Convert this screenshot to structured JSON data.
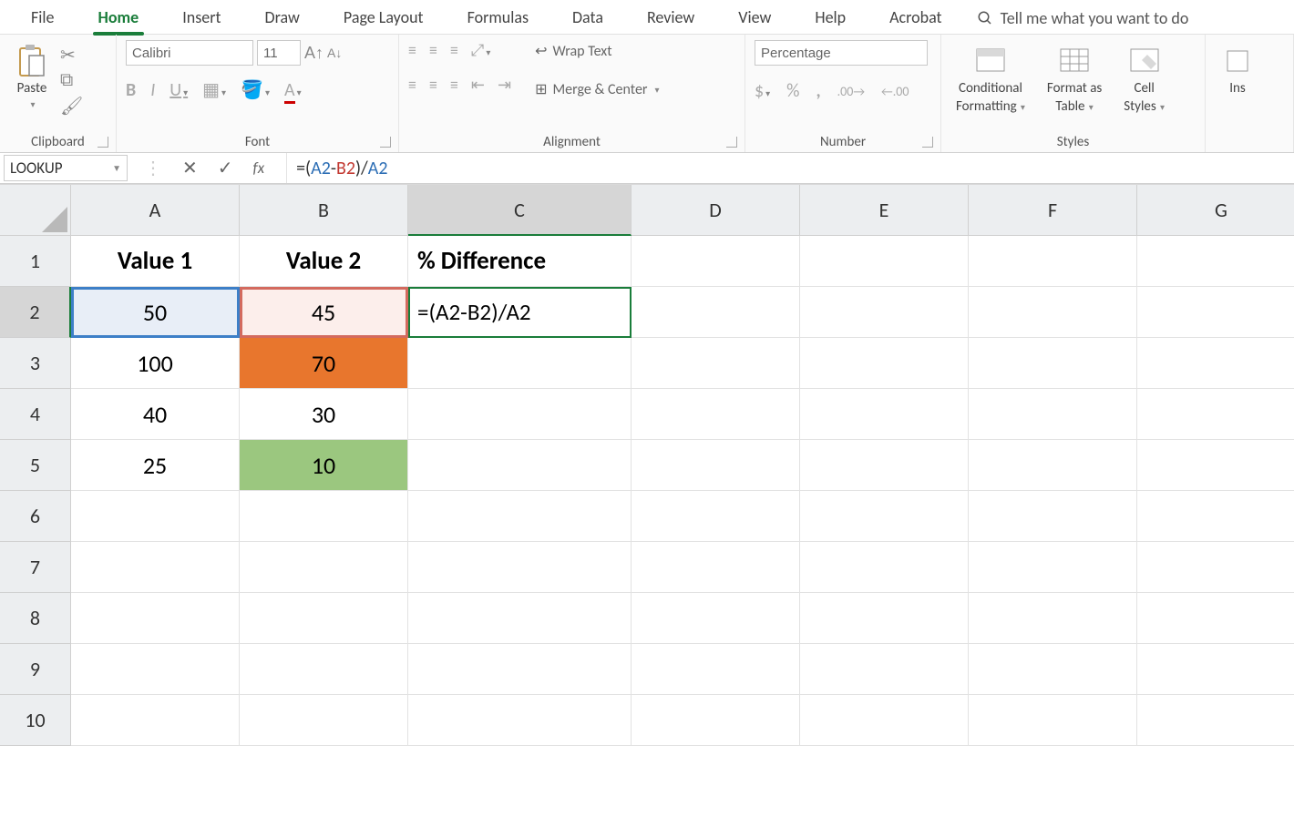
{
  "ribbon": {
    "tabs": [
      "File",
      "Home",
      "Insert",
      "Draw",
      "Page Layout",
      "Formulas",
      "Data",
      "Review",
      "View",
      "Help",
      "Acrobat"
    ],
    "active_tab": "Home",
    "tell_me_placeholder": "Tell me what you want to do",
    "groups": {
      "clipboard": {
        "label": "Clipboard",
        "paste": "Paste"
      },
      "font": {
        "label": "Font",
        "font_name": "Calibri",
        "font_size": "11",
        "bold": "B",
        "italic": "I",
        "underline": "U"
      },
      "alignment": {
        "label": "Alignment",
        "wrap_text": "Wrap Text",
        "merge_center": "Merge & Center"
      },
      "number": {
        "label": "Number",
        "format_name": "Percentage",
        "currency": "$",
        "percent": "%",
        "comma": ","
      },
      "styles": {
        "label": "Styles",
        "conditional": "Conditional Formatting",
        "conditional_l1": "Conditional",
        "conditional_l2": "Formatting",
        "format_table": "Format as Table",
        "format_table_l1": "Format as",
        "format_table_l2": "Table",
        "cell_styles": "Cell Styles",
        "cell_styles_l1": "Cell",
        "cell_styles_l2": "Styles"
      },
      "cells": {
        "insert": "Ins"
      }
    }
  },
  "name_box": "LOOKUP",
  "formula_bar": {
    "raw": "=(A2-B2)/A2",
    "prefix": "=(",
    "ref1": "A2",
    "mid": "-",
    "ref2": "B2",
    "suffix": ")/",
    "ref3": "A2"
  },
  "grid": {
    "columns": [
      "A",
      "B",
      "C",
      "D",
      "E",
      "F",
      "G"
    ],
    "rows": [
      "1",
      "2",
      "3",
      "4",
      "5",
      "6",
      "7",
      "8",
      "9",
      "10"
    ],
    "active_col": "C",
    "active_row": "2",
    "headers": {
      "A": "Value 1",
      "B": "Value 2",
      "C": "% Difference"
    },
    "data": {
      "A2": "50",
      "B2": "45",
      "C2": "=(A2-B2)/A2",
      "A3": "100",
      "B3": "70",
      "A4": "40",
      "B4": "30",
      "A5": "25",
      "B5": "10"
    },
    "ref_highlight": {
      "A2": "blue",
      "B2": "red"
    },
    "fills": {
      "B3": "orange",
      "B5": "green"
    }
  }
}
